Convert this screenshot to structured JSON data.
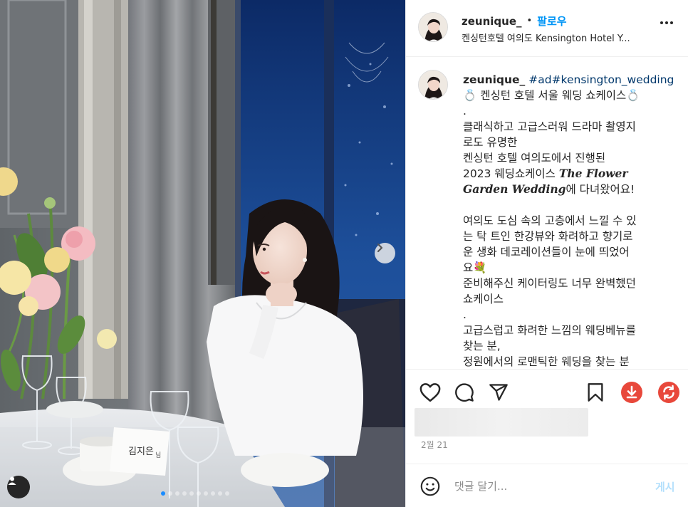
{
  "post": {
    "username": "zeunique_",
    "separator": "•",
    "follow_label": "팔로우",
    "location": "켄싱턴호텔 여의도 Kensington Hotel Y...",
    "more_icon": "more-horizontal-icon",
    "photo": {
      "name_card_text": "김지은",
      "name_card_suffix": "님",
      "carousel_count": 10,
      "carousel_active_index": 0
    },
    "caption": {
      "username": "zeunique_",
      "hashtags": "#ad#kensington_wedding",
      "lines": [
        "💍 켄싱턴 호텔 서울 웨딩 쇼케이스💍",
        ".",
        "클래식하고 고급스러워 드라마 촬영지",
        "로도 유명한",
        "켄싱턴 호텔 여의도에서 진행된",
        "2023 웨딩쇼케이스 ",
        "The Flower",
        "Garden Wedding",
        "에 다녀왔어요!",
        "여의도 도심 속의 고층에서 느낄 수 있",
        "는 탁 트인 한강뷰와 화려하고 향기로",
        "운 생화 데코레이션들이 눈에 띄었어",
        "요💐",
        "준비해주신 케이터링도 너무 완벽했던",
        "쇼케이스",
        ".",
        "고급스럽고 화려한 느낌의 웨딩베뉴를",
        "찾는 분,",
        "정원에서의 로맨틱한 웨딩을 찾는 분"
      ]
    },
    "date": "2월 21",
    "comment": {
      "placeholder": "댓글 달기...",
      "post_label": "게시"
    },
    "colors": {
      "accent": "#0095f6",
      "hashtag": "#00376b",
      "download": "#e8483b",
      "repost": "#e8483b"
    }
  }
}
